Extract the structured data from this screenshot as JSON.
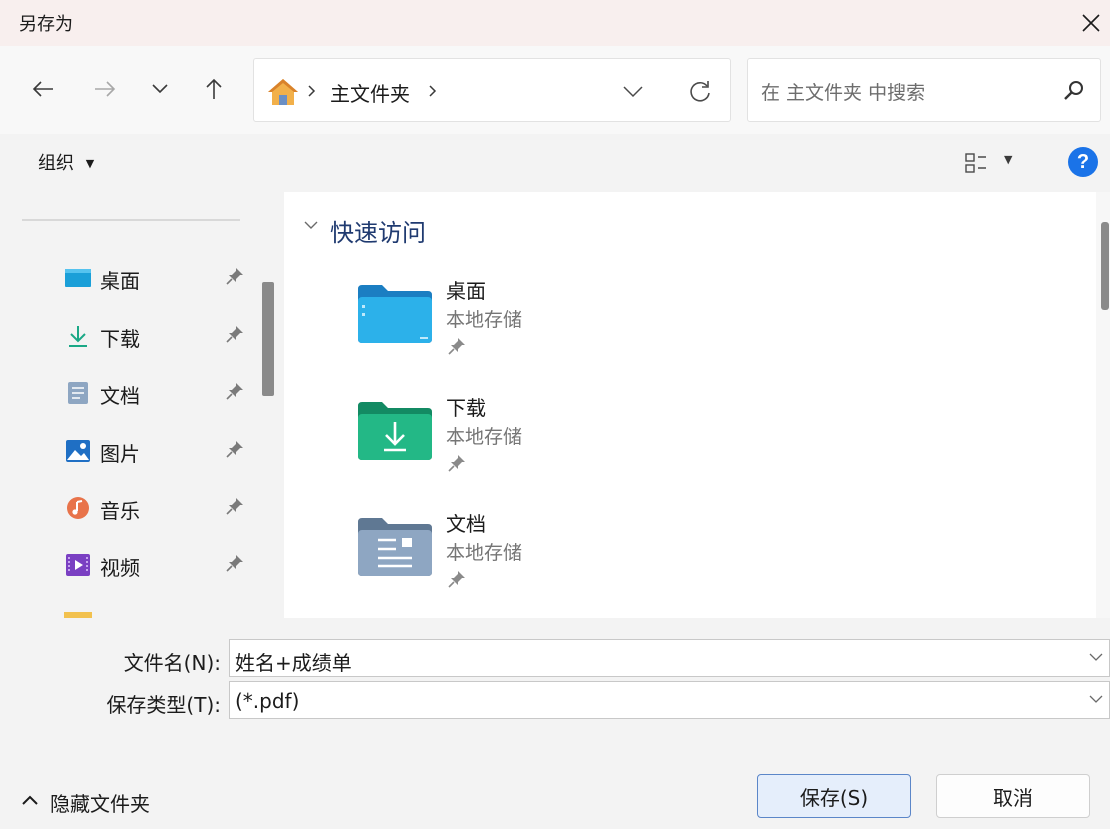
{
  "window": {
    "title": "另存为"
  },
  "address": {
    "breadcrumb": [
      {
        "label": "主文件夹"
      }
    ],
    "search_placeholder": "在 主文件夹 中搜索"
  },
  "toolbar": {
    "organize_label": "组织"
  },
  "sidebar": {
    "items": [
      {
        "label": "桌面",
        "icon": "desktop-icon"
      },
      {
        "label": "下载",
        "icon": "download-icon"
      },
      {
        "label": "文档",
        "icon": "document-icon"
      },
      {
        "label": "图片",
        "icon": "pictures-icon"
      },
      {
        "label": "音乐",
        "icon": "music-icon"
      },
      {
        "label": "视频",
        "icon": "videos-icon"
      }
    ]
  },
  "main": {
    "group_label": "快速访问",
    "items": [
      {
        "name": "桌面",
        "location": "本地存储"
      },
      {
        "name": "下载",
        "location": "本地存储"
      },
      {
        "name": "文档",
        "location": "本地存储"
      }
    ]
  },
  "form": {
    "filename_label": "文件名(N):",
    "filename_value": "姓名+成绩单",
    "filetype_label": "保存类型(T):",
    "filetype_value": "(*.pdf)"
  },
  "footer": {
    "hide_folders_label": "隐藏文件夹",
    "save_label": "保存(S)",
    "cancel_label": "取消"
  },
  "colors": {
    "titlebar_bg": "#f8efee",
    "accent": "#5b86c8",
    "help_blue": "#1a73e8",
    "group_header": "#1f3a70"
  }
}
